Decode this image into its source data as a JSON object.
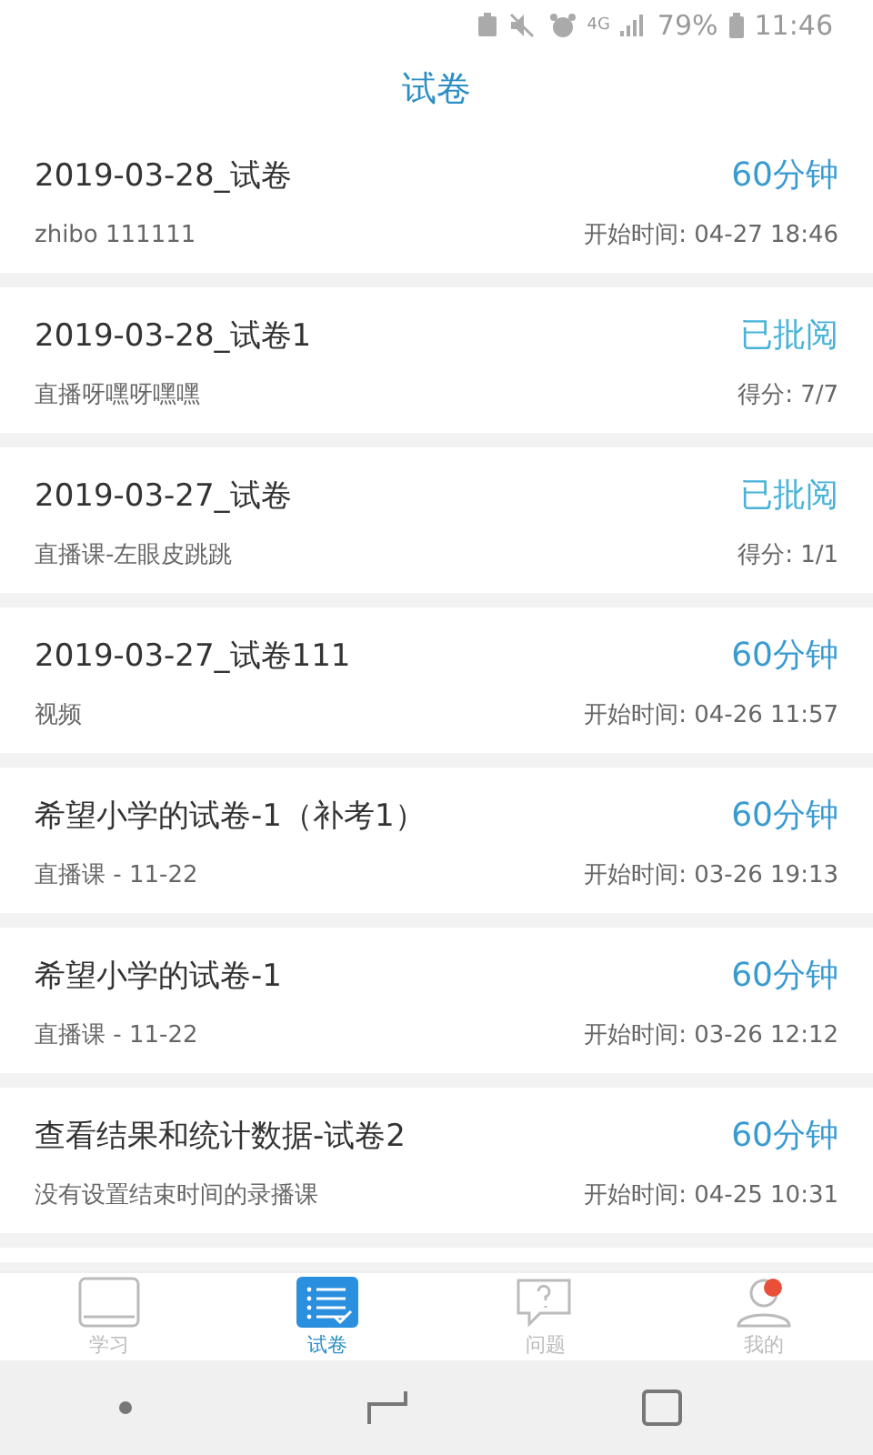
{
  "status_bar": {
    "network": "4G",
    "battery": "79%",
    "time": "11:46"
  },
  "title": "试卷",
  "papers": [
    {
      "name": "2019-03-28_试卷",
      "status": "60分钟",
      "kind": "timed",
      "subtitle": "zhibo 111111",
      "info": "开始时间: 04-27 18:46"
    },
    {
      "name": "2019-03-28_试卷1",
      "status": "已批阅",
      "kind": "graded",
      "subtitle": "直播呀嘿呀嘿嘿",
      "info": "得分: 7/7"
    },
    {
      "name": "2019-03-27_试卷",
      "status": "已批阅",
      "kind": "graded",
      "subtitle": "直播课-左眼皮跳跳",
      "info": "得分: 1/1"
    },
    {
      "name": "2019-03-27_试卷111",
      "status": "60分钟",
      "kind": "timed",
      "subtitle": "视频",
      "info": "开始时间: 04-26 11:57"
    },
    {
      "name": "希望小学的试卷-1（补考1）",
      "status": "60分钟",
      "kind": "timed",
      "subtitle": "直播课 - 11-22",
      "info": "开始时间: 03-26 19:13"
    },
    {
      "name": "希望小学的试卷-1",
      "status": "60分钟",
      "kind": "timed",
      "subtitle": "直播课 - 11-22",
      "info": "开始时间: 03-26 12:12"
    },
    {
      "name": "查看结果和统计数据-试卷2",
      "status": "60分钟",
      "kind": "timed",
      "subtitle": "没有设置结束时间的录播课",
      "info": "开始时间: 04-25 10:31"
    }
  ],
  "tabs": [
    {
      "label": "学习",
      "kind": "book",
      "selected": false
    },
    {
      "label": "试卷",
      "kind": "list",
      "selected": true
    },
    {
      "label": "问题",
      "kind": "question",
      "selected": false
    },
    {
      "label": "我的",
      "kind": "person",
      "selected": false
    }
  ]
}
